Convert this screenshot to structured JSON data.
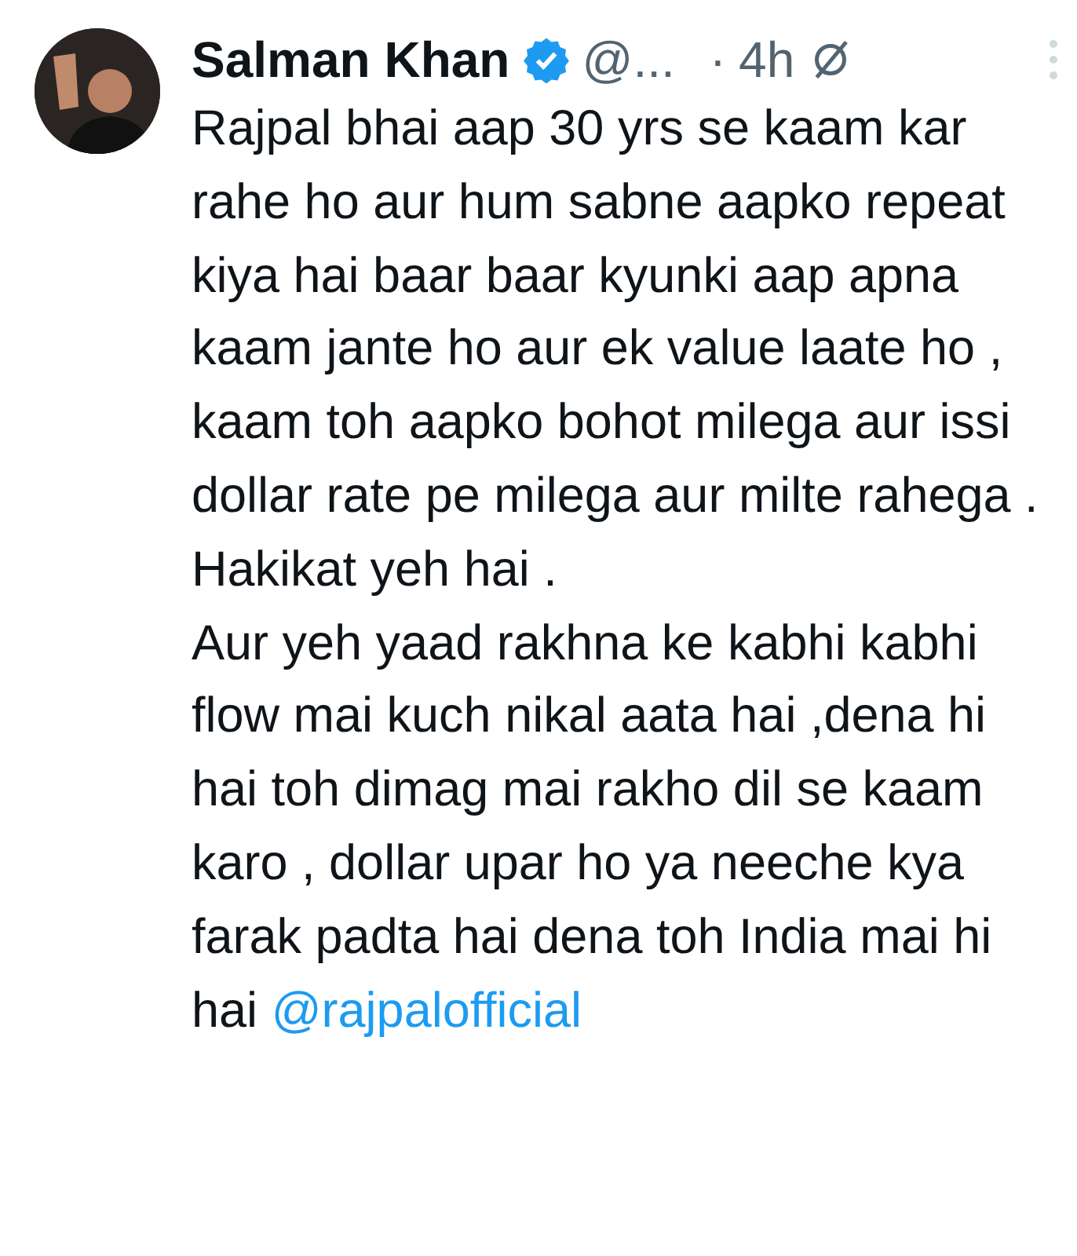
{
  "tweet": {
    "author": "Salman Khan",
    "verified": true,
    "handle": "@...",
    "separator": "·",
    "time": "4h",
    "paragraphs": [
      "Rajpal bhai aap 30 yrs se kaam kar rahe ho aur hum sabne aapko repeat kiya hai baar baar kyunki aap apna kaam jante ho aur ek value laate ho , kaam toh aapko bohot milega aur issi dollar rate pe milega aur milte rahega . Hakikat yeh hai .",
      "Aur yeh yaad rakhna ke kabhi kabhi flow mai kuch nikal aata hai ,dena hi hai toh dimag mai rakho dil se kaam karo , dollar upar ho ya neeche kya farak padta hai dena toh India mai hi hai"
    ],
    "mention": "@rajpalofficial"
  }
}
